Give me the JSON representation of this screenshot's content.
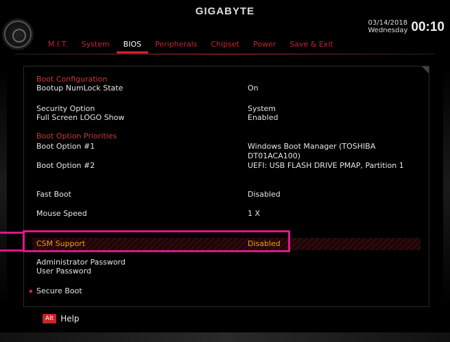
{
  "header": {
    "brand": "GIGABYTE",
    "date": "03/14/2018",
    "day": "Wednesday",
    "time": "00:10"
  },
  "tabs": [
    {
      "label": "M.I.T.",
      "active": false
    },
    {
      "label": "System",
      "active": false
    },
    {
      "label": "BIOS",
      "active": true
    },
    {
      "label": "Peripherals",
      "active": false
    },
    {
      "label": "Chipset",
      "active": false
    },
    {
      "label": "Power",
      "active": false
    },
    {
      "label": "Save & Exit",
      "active": false
    }
  ],
  "settings": {
    "boot_config_header": "Boot Configuration",
    "numlock": {
      "label": "Bootup NumLock State",
      "value": "On"
    },
    "security": {
      "label": "Security Option",
      "value": "System"
    },
    "logo": {
      "label": "Full Screen LOGO Show",
      "value": "Enabled"
    },
    "boot_priority_header": "Boot Option Priorities",
    "boot1": {
      "label": "Boot Option #1",
      "value": "Windows Boot Manager (TOSHIBA DT01ACA100)"
    },
    "boot2": {
      "label": "Boot Option #2",
      "value": "UEFI:  USB FLASH DRIVE PMAP, Partition 1"
    },
    "fastboot": {
      "label": "Fast Boot",
      "value": "Disabled"
    },
    "mouse": {
      "label": "Mouse Speed",
      "value": "1 X"
    },
    "csm": {
      "label": "CSM Support",
      "value": "Disabled"
    },
    "admin_pw": {
      "label": "Administrator Password"
    },
    "user_pw": {
      "label": "User Password"
    },
    "secure_boot": {
      "label": "Secure Boot"
    }
  },
  "footer": {
    "alt_key": "Alt",
    "help_label": "Help"
  },
  "colors": {
    "accent": "#d8232a",
    "highlight_text": "#f0a000",
    "annotation": "#e0168a"
  }
}
